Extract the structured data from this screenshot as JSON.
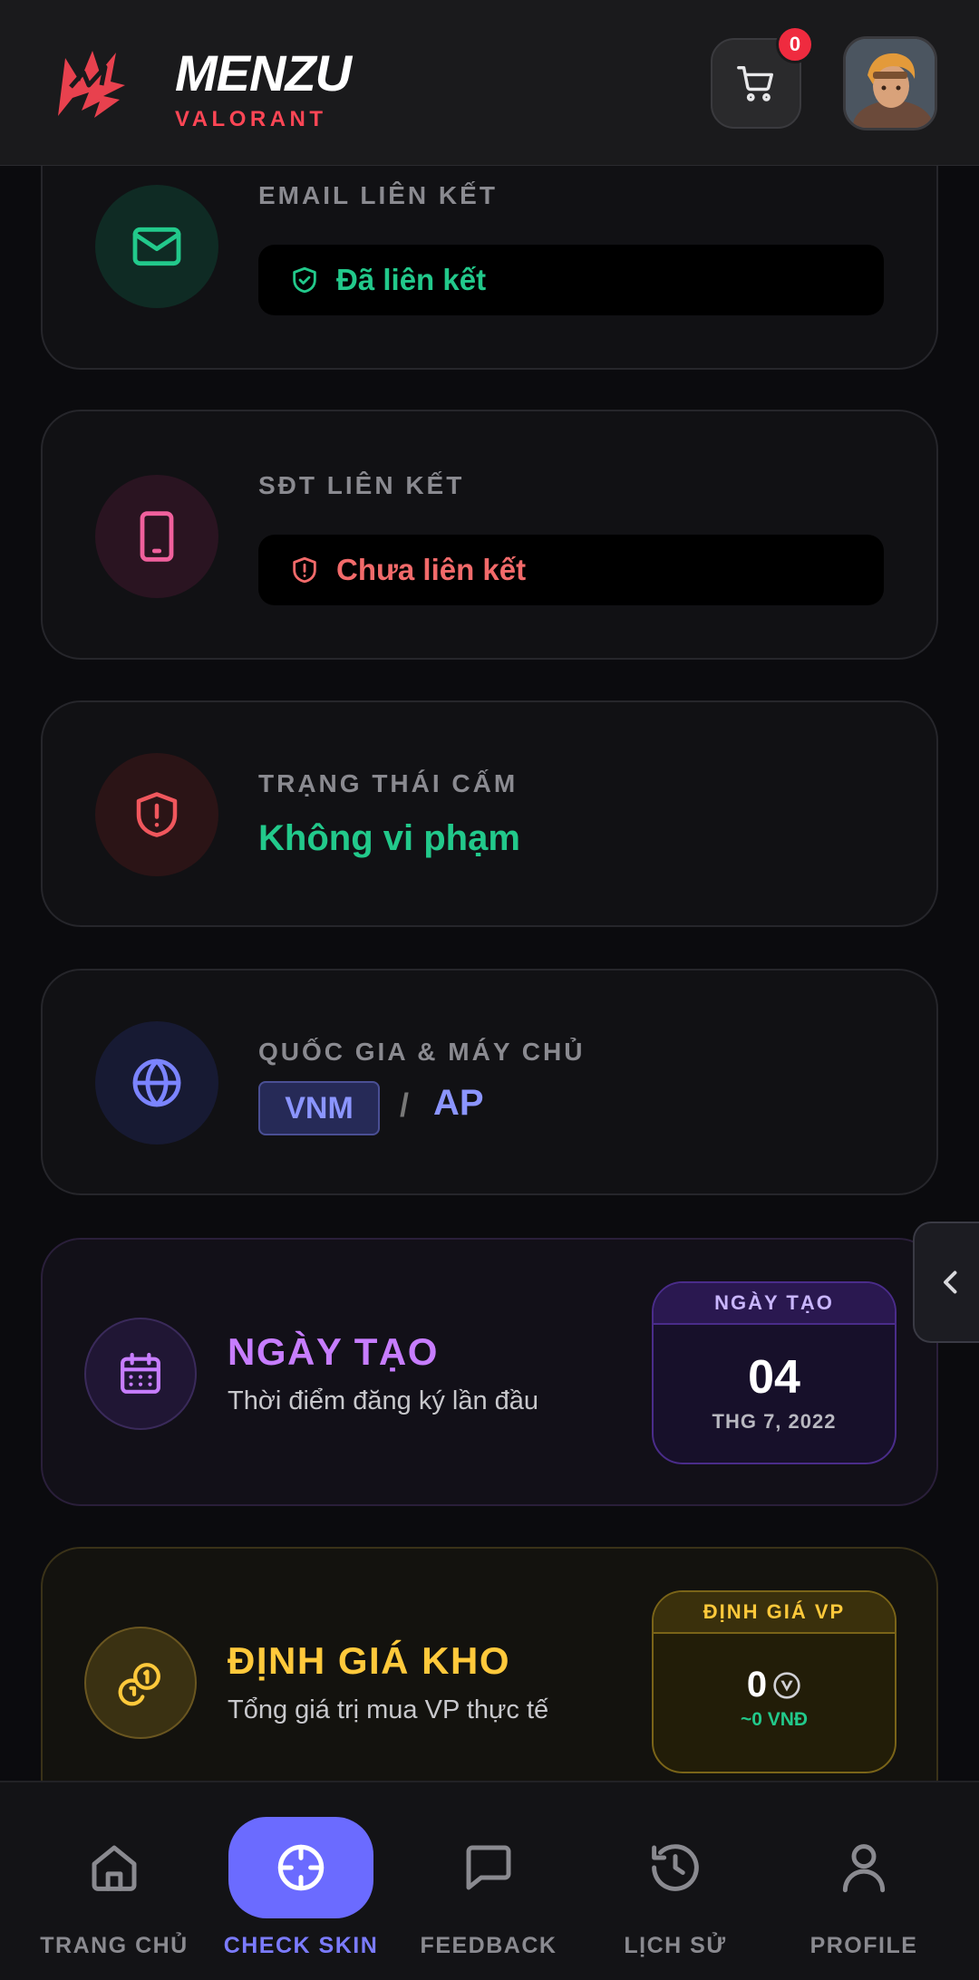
{
  "header": {
    "brand_name": "MENZU",
    "brand_sub": "VALORANT",
    "cart_count": "0",
    "icons": {
      "logo": "menzu-logo",
      "cart": "cart-icon",
      "avatar": "agent-avatar"
    }
  },
  "email": {
    "label": "EMAIL LIÊN KẾT",
    "status": "Đã liên kết",
    "status_color": "#22c98b",
    "icon": "mail-icon"
  },
  "phone": {
    "label": "SĐT LIÊN KẾT",
    "status": "Chưa liên kết",
    "status_color": "#f26a6a",
    "icon": "phone-icon"
  },
  "ban": {
    "label": "TRẠNG THÁI CẤM",
    "value": "Không vi phạm",
    "icon": "shield-alert-icon"
  },
  "region": {
    "label": "QUỐC GIA & MÁY CHỦ",
    "country": "VNM",
    "separator": "/",
    "server": "AP",
    "icon": "globe-icon"
  },
  "created": {
    "title": "NGÀY TẠO",
    "desc": "Thời điểm đăng ký lần đầu",
    "badge_title": "NGÀY TẠO",
    "day": "04",
    "month_year": "THG 7, 2022",
    "accent": "#c77dff",
    "icon": "calendar-icon"
  },
  "valuation": {
    "title": "ĐỊNH GIÁ KHO",
    "desc": "Tổng giá trị mua VP thực tế",
    "badge_title": "ĐỊNH GIÁ VP",
    "vp": "0",
    "vnd": "~0 VNĐ",
    "accent": "#ffc93b",
    "icon": "coins-icon"
  },
  "nav": {
    "items": [
      {
        "label": "TRANG CHỦ",
        "icon": "home-icon",
        "active": false
      },
      {
        "label": "CHECK SKIN",
        "icon": "crosshair-icon",
        "active": true
      },
      {
        "label": "FEEDBACK",
        "icon": "chat-icon",
        "active": false
      },
      {
        "label": "LỊCH SỬ",
        "icon": "history-icon",
        "active": false
      },
      {
        "label": "PROFILE",
        "icon": "user-icon",
        "active": false
      }
    ],
    "active_color": "#6b6bff"
  }
}
